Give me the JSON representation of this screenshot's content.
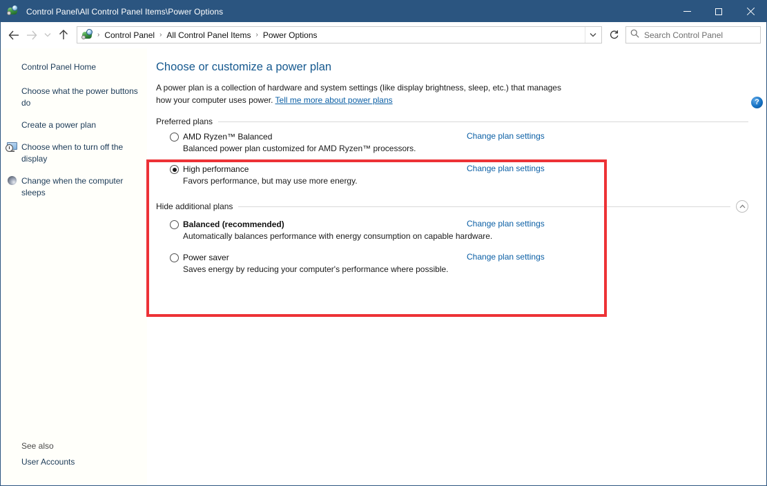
{
  "window": {
    "title": "Control Panel\\All Control Panel Items\\Power Options",
    "icon": "control-panel-icon",
    "minimize_label": "Minimize",
    "maximize_label": "Maximize",
    "close_label": "Close"
  },
  "nav": {
    "back_label": "Back",
    "forward_label": "Forward",
    "recent_label": "Recent locations",
    "up_label": "Up",
    "refresh_label": "Refresh",
    "address_dropdown_label": "Previous locations",
    "breadcrumbs": [
      "Control Panel",
      "All Control Panel Items",
      "Power Options"
    ],
    "separator": "›"
  },
  "search": {
    "placeholder": "Search Control Panel",
    "value": ""
  },
  "sidebar": {
    "home": "Control Panel Home",
    "items": [
      {
        "label": "Choose what the power buttons do",
        "icon": "none"
      },
      {
        "label": "Create a power plan",
        "icon": "none"
      },
      {
        "label": "Choose when to turn off the display",
        "icon": "display-clock-icon"
      },
      {
        "label": "Change when the computer sleeps",
        "icon": "moon-icon"
      }
    ],
    "see_also_label": "See also",
    "see_also_items": [
      "User Accounts"
    ]
  },
  "content": {
    "help_label": "?",
    "title": "Choose or customize a power plan",
    "description_part1": "A power plan is a collection of hardware and system settings (like display brightness, sleep, etc.) that manages how your computer uses power. ",
    "description_link": "Tell me more about power plans",
    "preferred_group_label": "Preferred plans",
    "additional_group_label": "Hide additional plans",
    "collapse_icon": "chevron-up-icon",
    "change_plan_label": "Change plan settings",
    "preferred_plans": [
      {
        "name": "AMD Ryzen™ Balanced",
        "description": "Balanced power plan customized for AMD Ryzen™ processors.",
        "selected": false,
        "bold": false,
        "change_label": "Change plan settings"
      },
      {
        "name": "High performance",
        "description": "Favors performance, but may use more energy.",
        "selected": true,
        "bold": false,
        "change_label": "Change plan settings"
      }
    ],
    "additional_plans": [
      {
        "name": "Balanced (recommended)",
        "description": "Automatically balances performance with energy consumption on capable hardware.",
        "selected": false,
        "bold": true,
        "change_label": "Change plan settings"
      },
      {
        "name": "Power saver",
        "description": "Saves energy by reducing your computer's performance where possible.",
        "selected": false,
        "bold": false,
        "change_label": "Change plan settings"
      }
    ]
  },
  "annotation": {
    "highlight_color": "#ed3236"
  }
}
